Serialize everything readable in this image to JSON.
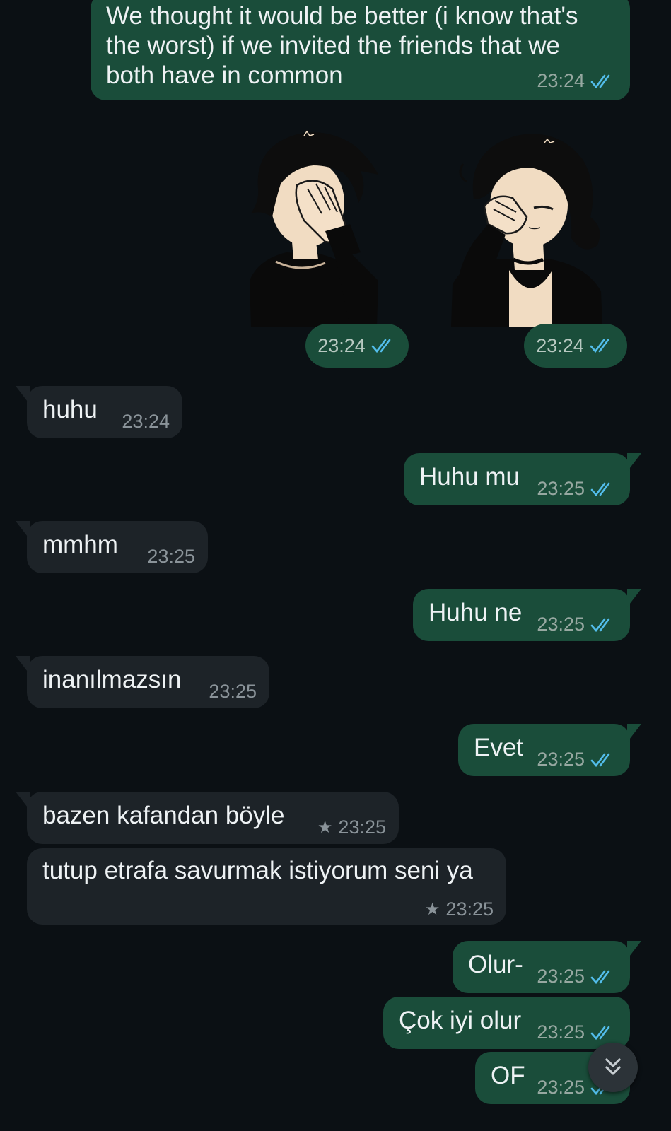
{
  "messages": [
    {
      "id": "m1",
      "direction": "out",
      "text": "We thought it would be better (i know that's\nthe worst) if we invited the friends that we\nboth have in common",
      "time": "23:24",
      "status": "read"
    },
    {
      "id": "s1",
      "direction": "out",
      "type": "sticker",
      "sticker": "boy-facepalm-sticker",
      "time": "23:24",
      "status": "read"
    },
    {
      "id": "s2",
      "direction": "out",
      "type": "sticker",
      "sticker": "girl-facepalm-sticker",
      "time": "23:24",
      "status": "read"
    },
    {
      "id": "m2",
      "direction": "in",
      "text": "huhu",
      "time": "23:24"
    },
    {
      "id": "m3",
      "direction": "out",
      "text": "Huhu mu",
      "time": "23:25",
      "status": "read"
    },
    {
      "id": "m4",
      "direction": "in",
      "text": "mmhm",
      "time": "23:25"
    },
    {
      "id": "m5",
      "direction": "out",
      "text": "Huhu ne",
      "time": "23:25",
      "status": "read"
    },
    {
      "id": "m6",
      "direction": "in",
      "text": "inanılmazsın",
      "time": "23:25"
    },
    {
      "id": "m7",
      "direction": "out",
      "text": "Evet",
      "time": "23:25",
      "status": "read"
    },
    {
      "id": "m8",
      "direction": "in",
      "text": "bazen kafandan böyle",
      "time": "23:25",
      "starred": true
    },
    {
      "id": "m9",
      "direction": "in",
      "text": "tutup etrafa savurmak istiyorum seni ya",
      "time": "23:25",
      "starred": true
    },
    {
      "id": "m10",
      "direction": "out",
      "text": "Olur-",
      "time": "23:25",
      "status": "read"
    },
    {
      "id": "m11",
      "direction": "out",
      "text": "Çok iyi olur",
      "time": "23:25",
      "status": "read"
    },
    {
      "id": "m12",
      "direction": "out",
      "text": "OF",
      "time": "23:25",
      "status": "read"
    }
  ],
  "colors": {
    "background": "#0b1014",
    "outgoing_bubble": "#1a4d3a",
    "incoming_bubble": "#1d2328",
    "read_tick": "#53bdeb"
  },
  "icons": {
    "read_receipt": "double-check-icon",
    "starred": "star-icon",
    "scroll_down": "chevron-double-down-icon"
  }
}
